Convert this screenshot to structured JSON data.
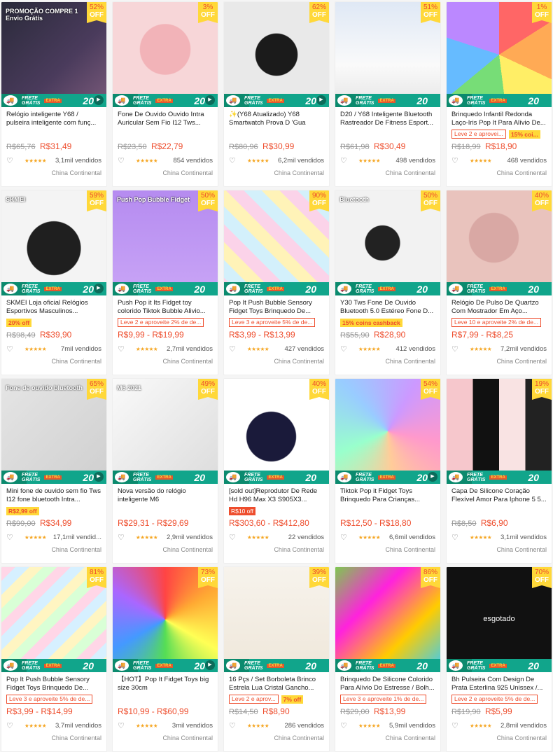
{
  "frete": {
    "line1": "FRETE",
    "line2": "GRÁTIS",
    "extra": "EXTRA",
    "acima": "ACIMA DE",
    "amount": "20"
  },
  "location": "China Continental",
  "icons": {
    "heart": "heart-outline-icon",
    "star": "star-icon",
    "play": "play-video-icon",
    "truck": "free-shipping-icon"
  },
  "colors": {
    "accent": "#ee4d2d",
    "badge": "#ffd839",
    "frete": "#11a58b"
  },
  "products": [
    {
      "title": "Relógio inteligente Y68 / pulseira inteligente com funç...",
      "disc": "52%",
      "old": "R$65,76",
      "price": "R$31,49",
      "sold": "3,1mil vendidos",
      "tags": [],
      "video": true,
      "img": "watch-promo",
      "overlay": "PROMOÇÃO COMPRE 1 Envio Grátis"
    },
    {
      "title": "Fone De Ouvido Ouvido Intra Auricular Sem Fio I12 Tws...",
      "disc": "3%",
      "old": "R$23,50",
      "price": "R$22,79",
      "sold": "854 vendidos",
      "tags": [],
      "video": true,
      "img": "pink-earbuds"
    },
    {
      "title": "✨(Y68 Atualizado) Y68 Smartwatch Prova D 'Gua Usb...",
      "disc": "62%",
      "old": "R$80,96",
      "price": "R$30,99",
      "sold": "6,2mil vendidos",
      "tags": [],
      "video": true,
      "img": "black-watch"
    },
    {
      "title": "D20 / Y68 Inteligente Bluetooth Rastreador De Fitness Esport...",
      "disc": "51%",
      "old": "R$61,98",
      "price": "R$30,49",
      "sold": "498 vendidos",
      "tags": [],
      "video": false,
      "img": "watch-colors"
    },
    {
      "title": "Brinquedo Infantil Redonda Laço-Iris Pop It Para Alívio De...",
      "disc": "1%",
      "old": "R$18,99",
      "price": "R$18,90",
      "sold": "468 vendidos",
      "tags": [
        {
          "type": "outline",
          "text": "Leve 2 e aprovei..."
        },
        {
          "type": "yellow",
          "text": "15% coi..."
        }
      ],
      "video": false,
      "img": "rainbow-pop"
    },
    {
      "title": "SKMEI Loja oficial Relógios Esportivos Masculinos...",
      "disc": "59%",
      "old": "R$98,49",
      "price": "R$39,90",
      "sold": "7mil vendidos",
      "tags": [
        {
          "type": "yellow",
          "text": "20% off"
        }
      ],
      "video": true,
      "img": "skmei",
      "overlay": "SKMEI"
    },
    {
      "title": "Push Pop it Its Fidget toy colorido Tiktok Bubble Alivio...",
      "disc": "50%",
      "old": "",
      "price": "R$9,99 - R$19,99",
      "sold": "2,7mil vendidos",
      "tags": [
        {
          "type": "outline",
          "text": "Leve 2 e aproveite 2% de de..."
        }
      ],
      "video": false,
      "img": "pop-shapes",
      "overlay": "Push Pop Bubble Fidget"
    },
    {
      "title": "Pop It Push Bubble Sensory Fidget Toys Brinquedo De...",
      "disc": "90%",
      "old": "",
      "price": "R$3,99 - R$13,99",
      "sold": "427 vendidos",
      "tags": [
        {
          "type": "outline",
          "text": "Leve 3 e aproveite 5% de de..."
        }
      ],
      "video": false,
      "img": "pop-shapes2"
    },
    {
      "title": "Y30 Tws Fone De Ouvido Bluetooth 5.0 Estéreo Fone D...",
      "disc": "50%",
      "old": "R$55,90",
      "price": "R$28,90",
      "sold": "412 vendidos",
      "tags": [
        {
          "type": "yellow",
          "text": "15% coins cashback"
        }
      ],
      "video": false,
      "img": "black-earbuds",
      "overlay": "Bluetooth"
    },
    {
      "title": "Relógio De Pulso De Quartzo Com Mostrador Em Aço...",
      "disc": "40%",
      "old": "",
      "price": "R$7,99 - R$8,25",
      "sold": "7,2mil vendidos",
      "tags": [
        {
          "type": "outline",
          "text": "Leve 10 e aproveite 2% de de..."
        }
      ],
      "video": false,
      "img": "pink-quartz"
    },
    {
      "title": "Mini fone de ouvido sem fio Tws I12 fone bluetooth Intra...",
      "disc": "65%",
      "old": "R$99,00",
      "price": "R$34,99",
      "sold": "17,1mil vendid...",
      "tags": [
        {
          "type": "yellow",
          "text": "R$2,99 off"
        }
      ],
      "video": true,
      "img": "cases",
      "overlay": "Fone de ouvido bluetooth"
    },
    {
      "title": "Nova versão do relógio inteligente M6",
      "disc": "49%",
      "old": "",
      "price": "R$29,31 - R$29,69",
      "sold": "2,9mil vendidos",
      "tags": [],
      "video": false,
      "img": "band-m6",
      "overlay": "M6 2021"
    },
    {
      "title": "[sold out]Reprodutor De Rede Hd H96 Max X3 S905X3...",
      "disc": "40%",
      "old": "",
      "price": "R$303,60 - R$412,80",
      "sold": "22 vendidos",
      "tags": [
        {
          "type": "solid",
          "text": "R$10 off"
        }
      ],
      "video": false,
      "img": "tvbox"
    },
    {
      "title": "Tiktok Pop it Fidget Toys Brinquedo Para Crianças...",
      "disc": "54%",
      "old": "",
      "price": "R$12,50 - R$18,80",
      "sold": "6,6mil vendidos",
      "tags": [],
      "video": true,
      "img": "unicorn-pop"
    },
    {
      "title": "Capa De Silicone Coração Flexível Amor Para Iphone 5 5...",
      "disc": "19%",
      "old": "R$8,50",
      "price": "R$6,90",
      "sold": "3,1mil vendidos",
      "tags": [],
      "video": false,
      "img": "phone-cases"
    },
    {
      "title": "Pop It Push Bubble Sensory Fidget Toys Brinquedo De...",
      "disc": "81%",
      "old": "",
      "price": "R$3,99 - R$14,99",
      "sold": "3,7mil vendidos",
      "tags": [
        {
          "type": "outline",
          "text": "Leve 3 e aproveite 5% de de..."
        }
      ],
      "video": false,
      "img": "pop-pastel"
    },
    {
      "title": "【HOT】Pop It Fidget Toys big size 30cm",
      "disc": "73%",
      "old": "",
      "price": "R$10,99 - R$60,99",
      "sold": "3mil vendidos",
      "tags": [],
      "video": true,
      "img": "big-pop"
    },
    {
      "title": "16 Pçs / Set Borboleta Brinco Estrela Lua Cristal Gancho...",
      "disc": "39%",
      "old": "R$14,50",
      "price": "R$8,90",
      "sold": "286 vendidos",
      "tags": [
        {
          "type": "outline",
          "text": "Leve 2 e aprov..."
        },
        {
          "type": "yellow",
          "text": "7% off"
        }
      ],
      "video": false,
      "img": "earrings"
    },
    {
      "title": "Brinquedo De Silicone Colorido Para Alívio Do Estresse / Bolh...",
      "disc": "86%",
      "old": "R$29,00",
      "price": "R$13,99",
      "sold": "5,9mil vendidos",
      "tags": [
        {
          "type": "outline",
          "text": "Leve 3 e aproveite 1% de de..."
        }
      ],
      "video": false,
      "img": "unicorn-pop2"
    },
    {
      "title": "Bh Pulseira Com Design De Prata Esterlina 925 Unissex /...",
      "disc": "70%",
      "old": "R$19,90",
      "price": "R$5,99",
      "sold": "2,8mil vendidos",
      "tags": [
        {
          "type": "outline",
          "text": "Leve 2 e aproveite 5% de de..."
        }
      ],
      "video": false,
      "img": "bracelet",
      "overlay": "esgotado"
    }
  ]
}
